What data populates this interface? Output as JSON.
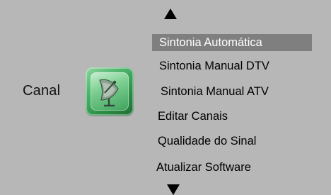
{
  "category": {
    "label": "Canal",
    "icon": "satellite-dish-icon"
  },
  "menu": {
    "items": [
      {
        "label": "Sintonia Automática",
        "selected": true
      },
      {
        "label": "Sintonia Manual DTV",
        "selected": false
      },
      {
        "label": "Sintonia Manual ATV",
        "selected": false
      },
      {
        "label": "Editar Canais",
        "selected": false
      },
      {
        "label": "Qualidade do Sinal",
        "selected": false
      },
      {
        "label": "Atualizar Software",
        "selected": false
      }
    ]
  },
  "colors": {
    "background": "#b7b7b7",
    "selected_bg": "#7f7f7f",
    "selected_text": "#ffffff",
    "icon_green": "#3fa35c"
  }
}
